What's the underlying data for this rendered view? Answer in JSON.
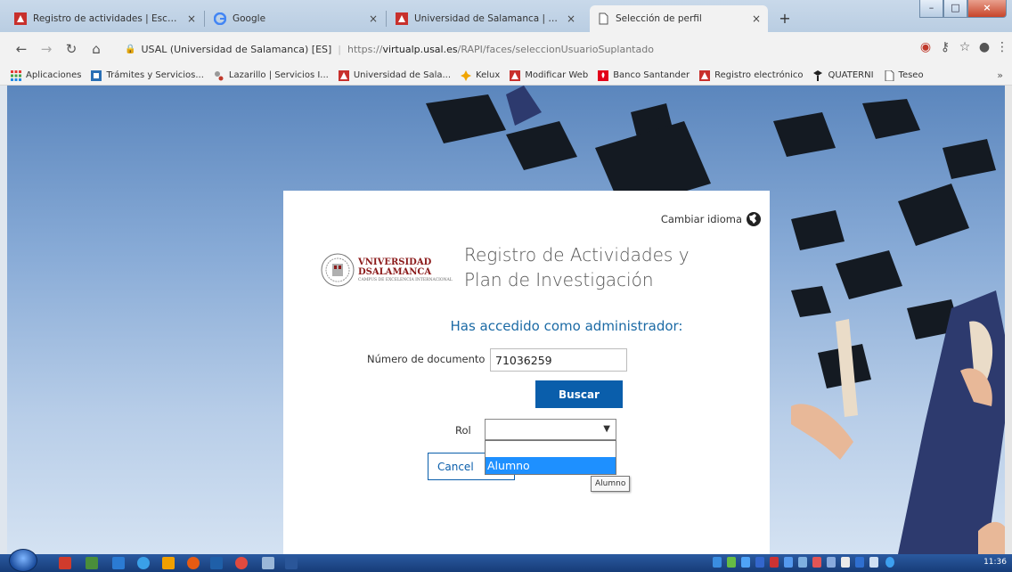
{
  "browser": {
    "tabs": [
      {
        "title": "Registro de actividades | Escuela",
        "favicon": "usal-logo-icon",
        "active": false
      },
      {
        "title": "Google",
        "favicon": "google-icon",
        "active": false
      },
      {
        "title": "Universidad de Salamanca | Univ",
        "favicon": "usal-logo-icon",
        "active": false
      },
      {
        "title": "Selección de perfil",
        "favicon": "page-icon",
        "active": true
      }
    ],
    "tab_close_glyph": "×",
    "new_tab_glyph": "+",
    "address": {
      "site_label": "USAL (Universidad de Salamanca) [ES]",
      "url_prefix": "https://",
      "url_host": "virtualp.usal.es",
      "url_path": "/RAPI/faces/seleccionUsuarioSuplantado"
    },
    "bookmarks": [
      {
        "label": "Aplicaciones",
        "icon": "apps-grid-icon"
      },
      {
        "label": "Trámites y Servicios...",
        "icon": "services-icon"
      },
      {
        "label": "Lazarillo | Servicios I...",
        "icon": "lazarillo-icon"
      },
      {
        "label": "Universidad de Sala...",
        "icon": "usal-logo-icon"
      },
      {
        "label": "Kelux",
        "icon": "kelux-icon"
      },
      {
        "label": "Modificar Web",
        "icon": "usal-logo-icon"
      },
      {
        "label": "Banco Santander",
        "icon": "santander-icon"
      },
      {
        "label": "Registro electrónico",
        "icon": "usal-logo-icon"
      },
      {
        "label": "QUATERNI",
        "icon": "quaterni-icon"
      },
      {
        "label": "Teseo",
        "icon": "page-icon"
      }
    ],
    "bookmarks_more": "»"
  },
  "page": {
    "change_language": "Cambiar idioma",
    "logo": {
      "line1": "VNIVERSIDAD",
      "line2": "DSALAMANCA",
      "line3": "CAMPUS DE EXCELENCIA INTERNACIONAL"
    },
    "app_title": "Registro de Actividades y Plan de Investigación",
    "heading": "Has accedido como administrador:",
    "document_label": "Número de documento",
    "document_value": "71036259",
    "search_button": "Buscar",
    "role_label": "Rol",
    "role_selected": "",
    "role_options": [
      "",
      "Alumno"
    ],
    "highlighted_option": "Alumno",
    "cancel_button": "Cancel",
    "tooltip": "Alumno"
  },
  "taskbar": {
    "clock": "11:36"
  },
  "colors": {
    "primary_blue": "#0a5eab",
    "heading_blue": "#1b6aa5",
    "usal_red": "#8b1a1a",
    "option_highlight": "#1e90ff"
  }
}
